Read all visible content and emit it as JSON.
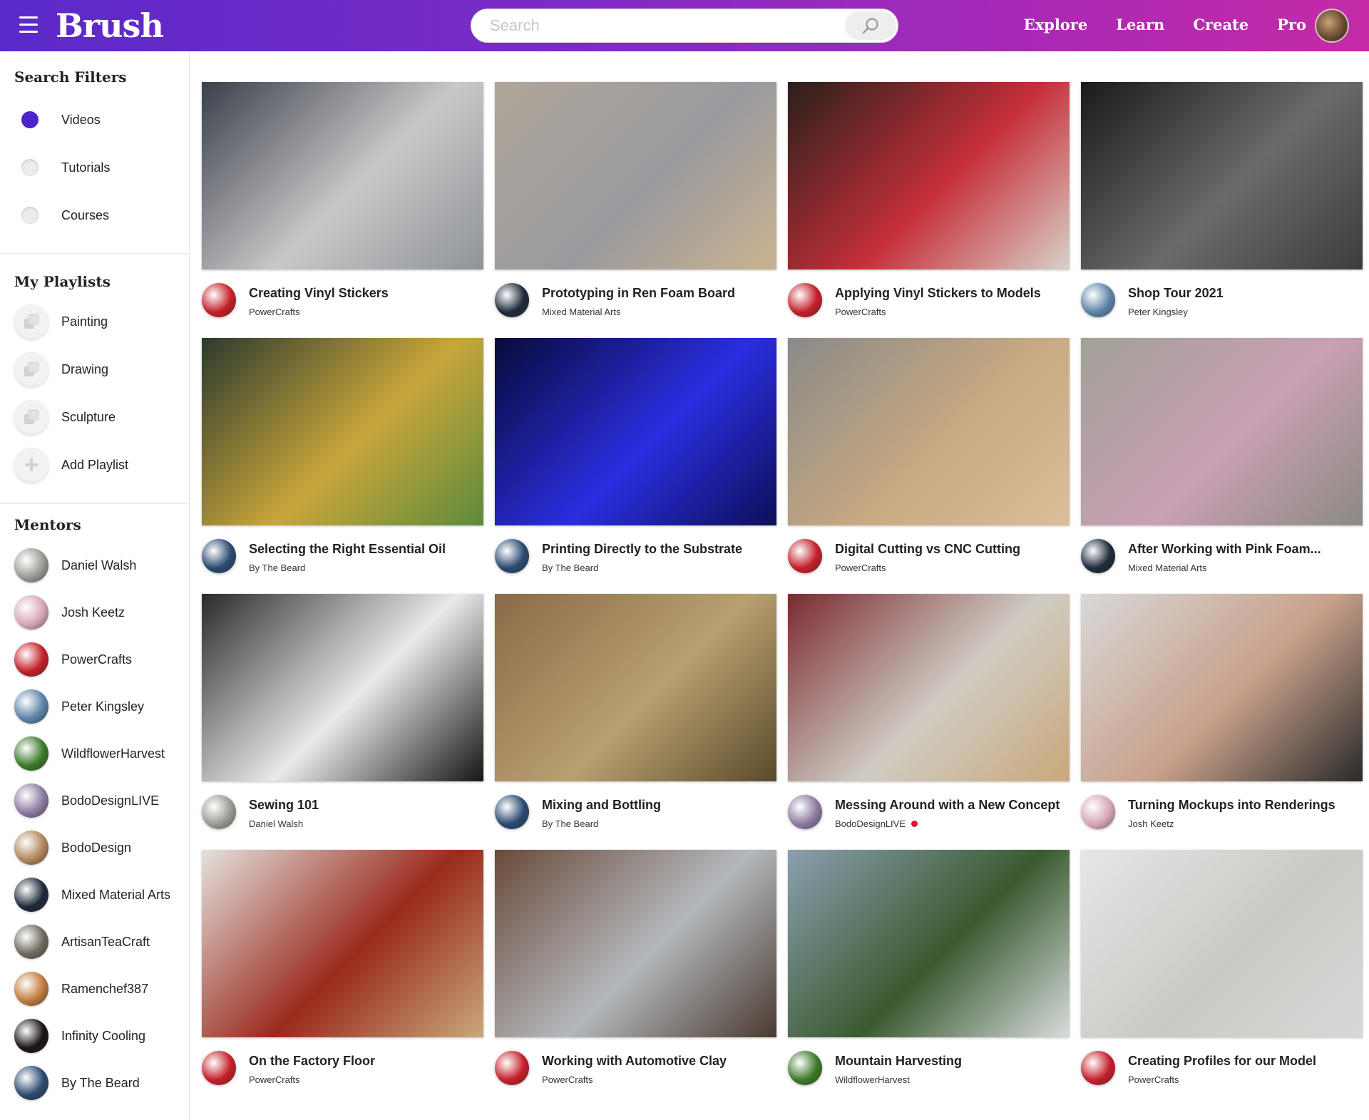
{
  "app": {
    "logo": "Brush",
    "search_placeholder": "Search"
  },
  "nav": [
    "Explore",
    "Learn",
    "Create",
    "Pro"
  ],
  "filters": {
    "title": "Search Filters",
    "items": [
      {
        "label": "Videos",
        "selected": true
      },
      {
        "label": "Tutorials",
        "selected": false
      },
      {
        "label": "Courses",
        "selected": false
      }
    ]
  },
  "playlists": {
    "title": "My Playlists",
    "items": [
      "Painting",
      "Drawing",
      "Sculpture"
    ],
    "add_label": "Add Playlist"
  },
  "mentors": {
    "title": "Mentors",
    "items": [
      {
        "name": "Daniel Walsh",
        "color": "#9a9a94"
      },
      {
        "name": "Josh Keetz",
        "color": "#d6a6b8"
      },
      {
        "name": "PowerCrafts",
        "color": "#c41f2a"
      },
      {
        "name": "Peter Kingsley",
        "color": "#5d83a8"
      },
      {
        "name": "WildflowerHarvest",
        "color": "#3c7a2a"
      },
      {
        "name": "BodoDesignLIVE",
        "color": "#8c7aa0"
      },
      {
        "name": "BodoDesign",
        "color": "#b0865c"
      },
      {
        "name": "Mixed Material Arts",
        "color": "#1e2b3a"
      },
      {
        "name": "ArtisanTeaCraft",
        "color": "#6d6a5c"
      },
      {
        "name": "Ramenchef387",
        "color": "#c07a3c"
      },
      {
        "name": "Infinity Cooling",
        "color": "#1a1418"
      },
      {
        "name": "By The Beard",
        "color": "#2b4a70"
      }
    ]
  },
  "videos": [
    {
      "title": "Creating Vinyl Stickers",
      "channel": "PowerCrafts",
      "live": false,
      "avatar": "#c41f2a",
      "thumb": [
        "#3a3f4a",
        "#c8c8c8",
        "#8f9399"
      ]
    },
    {
      "title": "Prototyping in Ren Foam Board",
      "channel": "Mixed Material Arts",
      "live": false,
      "avatar": "#1e2b3a",
      "thumb": [
        "#b0a79a",
        "#9a9a9e",
        "#c9b38f"
      ]
    },
    {
      "title": "Applying Vinyl Stickers to Models",
      "channel": "PowerCrafts",
      "live": false,
      "avatar": "#c41f2a",
      "thumb": [
        "#2a1f1a",
        "#c62f3a",
        "#d8d2c8"
      ]
    },
    {
      "title": "Shop Tour 2021",
      "channel": "Peter Kingsley",
      "live": false,
      "avatar": "#5d83a8",
      "thumb": [
        "#1a1a1a",
        "#6a6a6a",
        "#3d3d3d"
      ]
    },
    {
      "title": "Selecting the Right Essential Oil",
      "channel": "By The Beard",
      "live": false,
      "avatar": "#2b4a70",
      "thumb": [
        "#2c3a2e",
        "#c9a63a",
        "#5d8a3c"
      ]
    },
    {
      "title": "Printing Directly to the Substrate",
      "channel": "By The Beard",
      "live": false,
      "avatar": "#2b4a70",
      "thumb": [
        "#080a3a",
        "#2a2ee0",
        "#0c0f58"
      ]
    },
    {
      "title": "Digital Cutting vs CNC Cutting",
      "channel": "PowerCrafts",
      "live": false,
      "avatar": "#c41f2a",
      "thumb": [
        "#8a8a88",
        "#c8a982",
        "#d9bf99"
      ]
    },
    {
      "title": "After Working with Pink Foam...",
      "channel": "Mixed Material Arts",
      "live": false,
      "avatar": "#1e2b3a",
      "thumb": [
        "#a2a198",
        "#c9a0b4",
        "#8b8a82"
      ]
    },
    {
      "title": "Sewing 101",
      "channel": "Daniel Walsh",
      "live": false,
      "avatar": "#9a9a94",
      "thumb": [
        "#2a2a2a",
        "#e9e9e9",
        "#151515"
      ]
    },
    {
      "title": "Mixing and Bottling",
      "channel": "By The Beard",
      "live": false,
      "avatar": "#2b4a70",
      "thumb": [
        "#8a6a48",
        "#b8a070",
        "#5a4a2a"
      ]
    },
    {
      "title": "Messing Around with a New Concept",
      "channel": "BodoDesignLIVE",
      "live": true,
      "avatar": "#8c7aa0",
      "thumb": [
        "#7a2a30",
        "#d0ccc4",
        "#c9a87a"
      ]
    },
    {
      "title": "Turning Mockups into Renderings",
      "channel": "Josh Keetz",
      "live": false,
      "avatar": "#d6a6b8",
      "thumb": [
        "#d8d8d8",
        "#c8a08a",
        "#2a2a2a"
      ]
    },
    {
      "title": "On the Factory Floor",
      "channel": "PowerCrafts",
      "live": false,
      "avatar": "#c41f2a",
      "thumb": [
        "#e4e2de",
        "#9a2a1c",
        "#c9a87a"
      ]
    },
    {
      "title": "Working with Automotive Clay",
      "channel": "PowerCrafts",
      "live": false,
      "avatar": "#c41f2a",
      "thumb": [
        "#6a4a3a",
        "#b4b8bc",
        "#4a3a30"
      ]
    },
    {
      "title": "Mountain Harvesting",
      "channel": "WildflowerHarvest",
      "live": false,
      "avatar": "#3c7a2a",
      "thumb": [
        "#8aa0b0",
        "#3a5a30",
        "#d8dcdc"
      ]
    },
    {
      "title": "Creating Profiles for our Model",
      "channel": "PowerCrafts",
      "live": false,
      "avatar": "#c41f2a",
      "thumb": [
        "#e6e6e4",
        "#c9c9c6",
        "#d8d8d6"
      ]
    }
  ]
}
